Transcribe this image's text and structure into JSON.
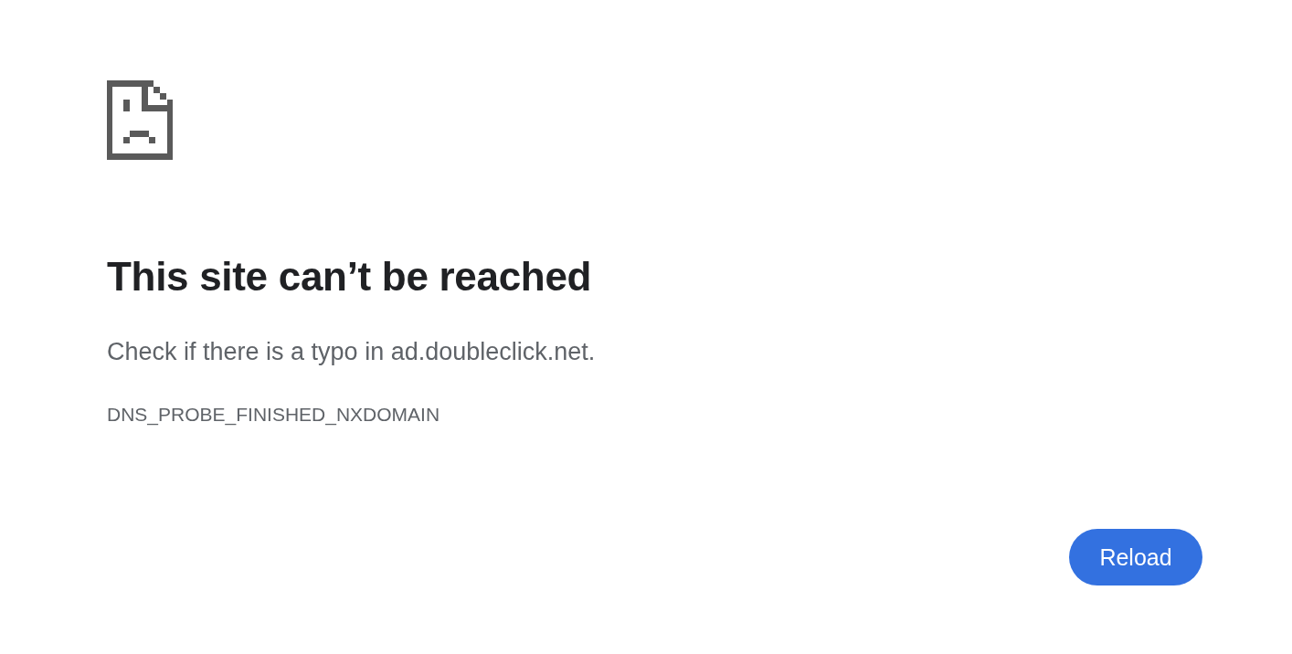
{
  "title": "This site can’t be reached",
  "message": "Check if there is a typo in ad.doubleclick.net.",
  "error_code": "DNS_PROBE_FINISHED_NXDOMAIN",
  "buttons": [
    {
      "label": "Reload"
    }
  ]
}
